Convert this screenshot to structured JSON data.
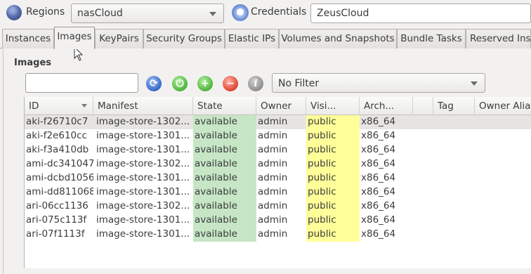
{
  "topbar": {
    "regions_label": "Regions",
    "region_value": "nasCloud",
    "credentials_label": "Credentials",
    "credentials_value": "ZeusCloud"
  },
  "tabs": [
    {
      "label": "Instances"
    },
    {
      "label": "Images"
    },
    {
      "label": "KeyPairs"
    },
    {
      "label": "Security Groups"
    },
    {
      "label": "Elastic IPs"
    },
    {
      "label": "Volumes and Snapshots"
    },
    {
      "label": "Bundle Tasks"
    },
    {
      "label": "Reserved Inst"
    }
  ],
  "images": {
    "title": "Images",
    "search_value": "",
    "filter_value": "No Filter",
    "columns": [
      "ID",
      "Manifest",
      "State",
      "Owner",
      "Visi...",
      "Arch...",
      "",
      "Tag",
      "Owner Alias"
    ],
    "rows": [
      [
        "aki-f26710c7",
        "image-store-1302...",
        "available",
        "admin",
        "public",
        "x86_64"
      ],
      [
        "aki-f2e610cc",
        "image-store-1301...",
        "available",
        "admin",
        "public",
        "x86_64"
      ],
      [
        "aki-f3a410db",
        "image-store-1301...",
        "available",
        "admin",
        "public",
        "x86_64"
      ],
      [
        "ami-dc341047",
        "image-store-1302...",
        "available",
        "admin",
        "public",
        "x86_64"
      ],
      [
        "ami-dcbd1056",
        "image-store-1301...",
        "available",
        "admin",
        "public",
        "x86_64"
      ],
      [
        "ami-dd811068",
        "image-store-1301...",
        "available",
        "admin",
        "public",
        "x86_64"
      ],
      [
        "ari-06cc1136",
        "image-store-1302...",
        "available",
        "admin",
        "public",
        "x86_64"
      ],
      [
        "ari-075c113f",
        "image-store-1301...",
        "available",
        "admin",
        "public",
        "x86_64"
      ],
      [
        "ari-07f1113f",
        "image-store-1301...",
        "available",
        "admin",
        "public",
        "x86_64"
      ]
    ]
  },
  "colors": {
    "state_bg": "#c6e6c6",
    "visibility_bg": "#ffff99",
    "selected_row_bg": "#e6e5e3"
  }
}
